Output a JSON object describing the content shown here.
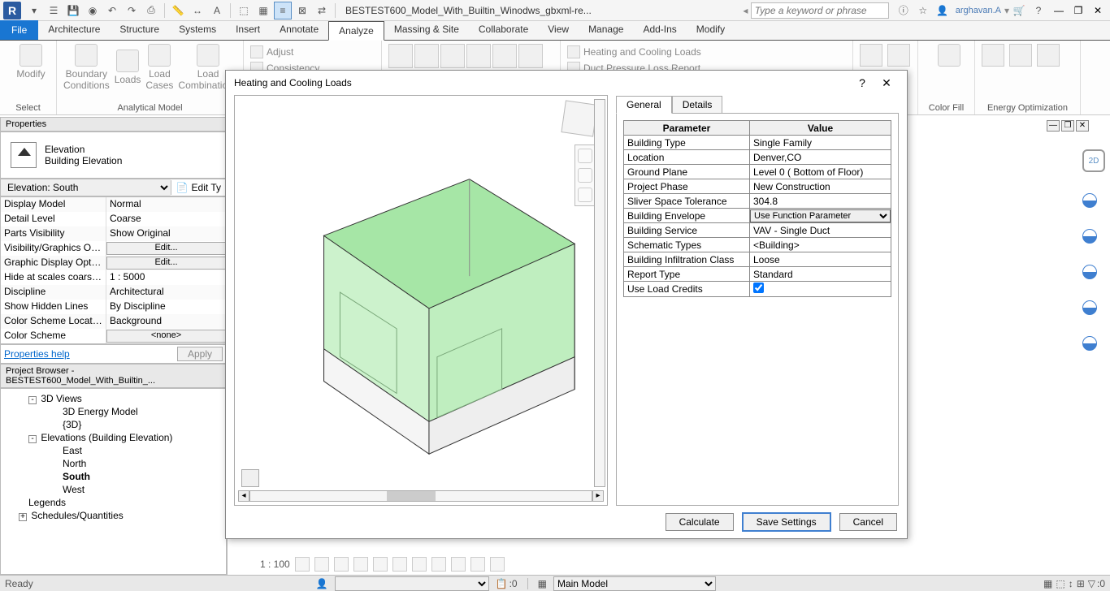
{
  "qat": {
    "title": "BESTEST600_Model_With_Builtin_Winodws_gbxml-re...",
    "search_placeholder": "Type a keyword or phrase",
    "user": "arghavan.A"
  },
  "file_tab": "File",
  "tabs": [
    "Architecture",
    "Structure",
    "Systems",
    "Insert",
    "Annotate",
    "Analyze",
    "Massing & Site",
    "Collaborate",
    "View",
    "Manage",
    "Add-Ins",
    "Modify"
  ],
  "active_tab": "Analyze",
  "ribbon": {
    "panel_select": "Select",
    "modify": "Modify",
    "boundary": "Boundary\nConditions",
    "loads": "Loads",
    "load_cases": "Load\nCases",
    "load_comb": "Load\nCombinations",
    "panel_model": "Analytical Model",
    "adjust": "Adjust",
    "consistency": "Consistency",
    "hcl": "Heating and   Cooling Loads",
    "duct": "Duct Pressure   Loss Report",
    "colorfill": "Color Fill",
    "energy": "Energy Optimization"
  },
  "properties": {
    "header": "Properties",
    "type_name": "Elevation",
    "type_sub": "Building Elevation",
    "selector": "Elevation: South",
    "edit_type": "Edit Ty",
    "rows": [
      {
        "k": "Display Model",
        "v": "Normal"
      },
      {
        "k": "Detail Level",
        "v": "Coarse"
      },
      {
        "k": "Parts Visibility",
        "v": "Show Original"
      },
      {
        "k": "Visibility/Graphics Ov...",
        "btn": "Edit..."
      },
      {
        "k": "Graphic Display Optio...",
        "btn": "Edit..."
      },
      {
        "k": "Hide at scales coarser ...",
        "v": "1 : 5000"
      },
      {
        "k": "Discipline",
        "v": "Architectural"
      },
      {
        "k": "Show Hidden Lines",
        "v": "By Discipline"
      },
      {
        "k": "Color Scheme Location",
        "v": "Background"
      },
      {
        "k": "Color Scheme",
        "btn": "<none>"
      }
    ],
    "help": "Properties help",
    "apply": "Apply"
  },
  "browser": {
    "header": "Project Browser - BESTEST600_Model_With_Builtin_...",
    "items": [
      {
        "lvl": 1,
        "exp": "-",
        "label": "3D Views"
      },
      {
        "lvl": 3,
        "label": "3D Energy Model"
      },
      {
        "lvl": 3,
        "label": "{3D}"
      },
      {
        "lvl": 1,
        "exp": "-",
        "label": "Elevations (Building Elevation)"
      },
      {
        "lvl": 3,
        "label": "East"
      },
      {
        "lvl": 3,
        "label": "North"
      },
      {
        "lvl": 3,
        "label": "South",
        "bold": true
      },
      {
        "lvl": 3,
        "label": "West"
      },
      {
        "lvl": 1,
        "label": "Legends"
      },
      {
        "lvl": 0,
        "exp": "+",
        "label": "Schedules/Quantities"
      }
    ]
  },
  "view_ctrl": {
    "scale": "1 : 100"
  },
  "status": {
    "ready": "Ready",
    "sel_count": ":0",
    "filter_count": ":0",
    "model": "Main Model"
  },
  "dialog": {
    "title": "Heating and Cooling Loads",
    "tabs": [
      "General",
      "Details"
    ],
    "active_tab": "General",
    "th_param": "Parameter",
    "th_value": "Value",
    "params": [
      {
        "k": "Building Type",
        "v": "Single Family"
      },
      {
        "k": "Location",
        "v": "Denver,CO"
      },
      {
        "k": "Ground Plane",
        "v": "Level 0 ( Bottom of Floor)"
      },
      {
        "k": "Project Phase",
        "v": "New Construction"
      },
      {
        "k": "Sliver Space Tolerance",
        "v": "304.8"
      },
      {
        "k": "Building Envelope",
        "v": "Use Function Parameter",
        "dropdown": true
      },
      {
        "k": "Building Service",
        "v": "VAV - Single Duct"
      },
      {
        "k": "Schematic Types",
        "v": "<Building>"
      },
      {
        "k": "Building Infiltration Class",
        "v": "Loose"
      },
      {
        "k": "Report Type",
        "v": "Standard"
      },
      {
        "k": "Use Load Credits",
        "checkbox": true,
        "checked": true
      }
    ],
    "btn_calc": "Calculate",
    "btn_save": "Save Settings",
    "btn_cancel": "Cancel"
  }
}
